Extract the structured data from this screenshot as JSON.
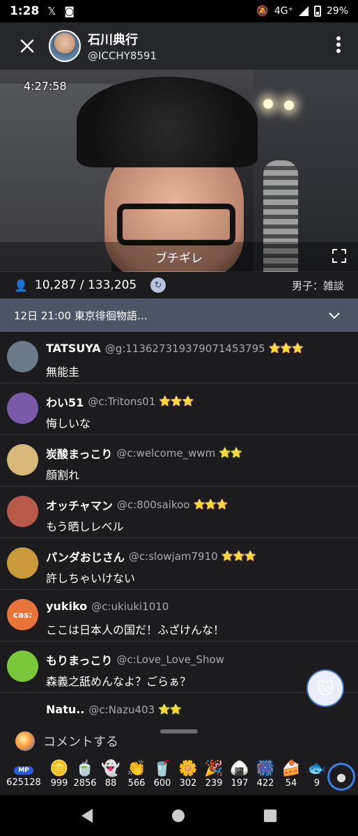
{
  "status_bar": {
    "time": "1:28",
    "network": "4G⁺",
    "battery": "29%"
  },
  "header": {
    "host_name": "石川典行",
    "host_id": "@ICCHY8591"
  },
  "video": {
    "elapsed": "4:27:58",
    "caption": "ブチギレ"
  },
  "stats": {
    "viewers": "10,287 / 133,205",
    "category": "男子：雑談"
  },
  "event": {
    "text": "12日 21:00 東京徘徊物語…"
  },
  "comments": [
    {
      "name": "TATSUYA",
      "uid": "@g:113627319379071453795",
      "badge": "⭐⭐⭐",
      "badge_color": "#8a3ab8",
      "text": "無能圭",
      "avatar_color": "#6a7a8a"
    },
    {
      "name": "わい51",
      "uid": "@c:Tritons01",
      "badge": "⭐⭐⭐",
      "badge_color": "#8a3ab8",
      "text": "悔しいな",
      "avatar_color": "#7a5aa8"
    },
    {
      "name": "炭酸まっこり",
      "uid": "@c:welcome_wwm",
      "badge": "⭐⭐",
      "badge_color": "#3a9a4a",
      "text": "顔割れ",
      "avatar_color": "#d8b878"
    },
    {
      "name": "オッチャマン",
      "uid": "@c:800saikoo",
      "badge": "⭐⭐⭐",
      "badge_color": "#8a3ab8",
      "text": "もう晒しレベル",
      "avatar_color": "#b85a4a"
    },
    {
      "name": "パンダおじさん",
      "uid": "@c:slowjam7910",
      "badge": "⭐⭐⭐",
      "badge_color": "#8a3ab8",
      "text": "許しちゃいけない",
      "avatar_color": "#c89a3a"
    },
    {
      "name": "yukiko",
      "uid": "@c:ukiuki1010",
      "badge": "",
      "badge_color": "#000000",
      "text": "ここは日本人の国だ！ふざけんな！",
      "avatar_color": "#e8743a",
      "avatar_text": "cas:"
    },
    {
      "name": "もりまっこり",
      "uid": "@c:Love_Love_Show",
      "badge": "",
      "badge_color": "#000000",
      "text": "森義之舐めんなよ？ごらぁ？",
      "avatar_color": "#7ac83a"
    },
    {
      "name": "Natu..",
      "uid": "@c:Nazu403",
      "badge": "⭐⭐",
      "badge_color": "#3a9a4a",
      "text": "",
      "avatar_color": "#1c1c1f"
    }
  ],
  "comment_input": {
    "placeholder": "コメントする"
  },
  "mp": {
    "label": "MP",
    "count": "625128"
  },
  "gifts": [
    {
      "icon": "coin-icon",
      "glyph": "🪙",
      "count": "999"
    },
    {
      "icon": "tea-icon",
      "glyph": "🍵",
      "count": "2856"
    },
    {
      "icon": "ghost-icon",
      "glyph": "👻",
      "count": "88"
    },
    {
      "icon": "clap-icon",
      "glyph": "👏",
      "count": "566"
    },
    {
      "icon": "drink-icon",
      "glyph": "🥤",
      "count": "600"
    },
    {
      "icon": "flower-icon",
      "glyph": "🌼",
      "count": "302"
    },
    {
      "icon": "party-icon",
      "glyph": "🎉",
      "count": "239"
    },
    {
      "icon": "onigiri-icon",
      "glyph": "🍙",
      "count": "197"
    },
    {
      "icon": "fireworks-icon",
      "glyph": "🎆",
      "count": "422"
    },
    {
      "icon": "cake-icon",
      "glyph": "🍰",
      "count": "54"
    },
    {
      "icon": "fish-icon",
      "glyph": "🐟",
      "count": "9"
    }
  ]
}
